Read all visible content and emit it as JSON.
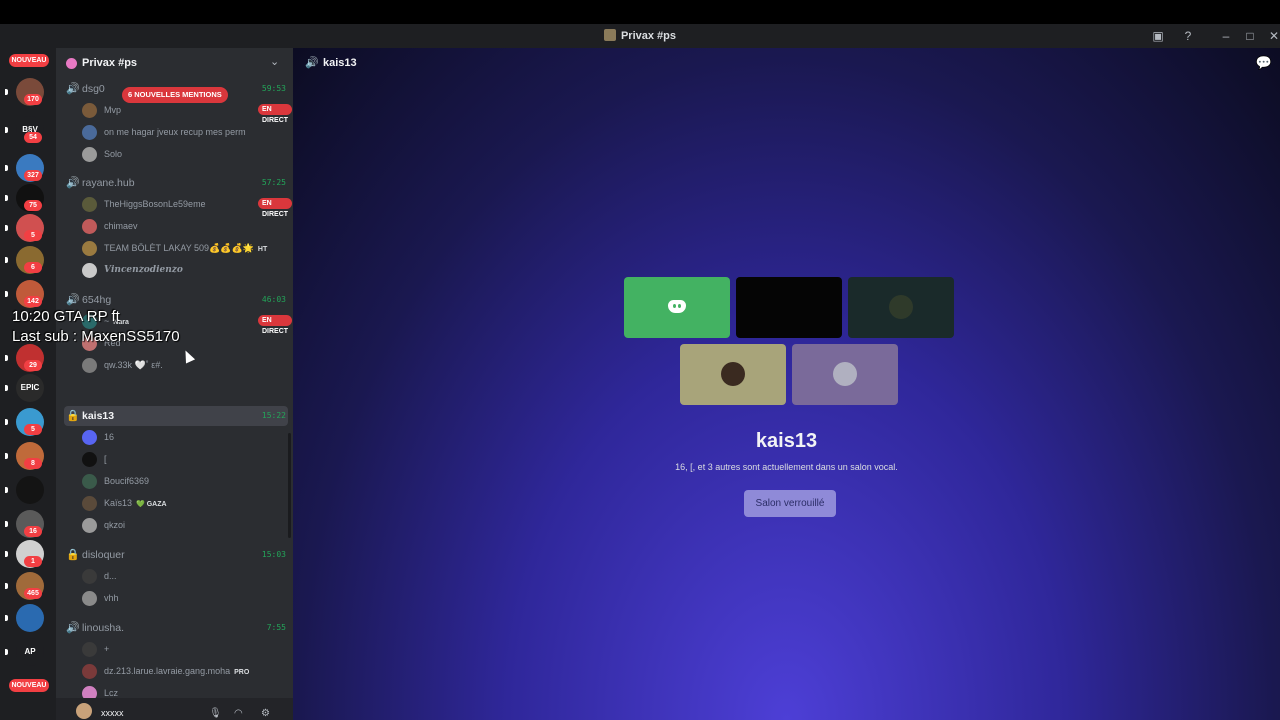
{
  "window": {
    "title": "Privax #ps"
  },
  "guilds": {
    "nouveau_top": "NOUVEAU",
    "nouveau_bottom": "NOUVEAU",
    "items": [
      {
        "badge": "170",
        "color": "#7a4a3a"
      },
      {
        "label": "B§V",
        "badge": "54",
        "color": "#1e1f22"
      },
      {
        "badge": "327",
        "color": "#3a7ac0"
      },
      {
        "badge": "75",
        "color": "#111111"
      },
      {
        "badge": "5",
        "color": "#d05050"
      },
      {
        "badge": "6",
        "color": "#8a6a30"
      },
      {
        "badge": "142",
        "color": "#c05a3a"
      },
      {
        "badge": "29",
        "color": "#c03030"
      },
      {
        "label": "EPIC",
        "badge": "",
        "color": "#2a2a2a"
      },
      {
        "badge": "5",
        "color": "#3a9ad0"
      },
      {
        "badge": "8",
        "color": "#c06a3a"
      },
      {
        "badge": "",
        "color": "#141414"
      },
      {
        "badge": "16",
        "color": "#5a5a5a"
      },
      {
        "badge": "1",
        "color": "#d0d0d0"
      },
      {
        "badge": "465",
        "color": "#a06a3a"
      },
      {
        "badge": "",
        "color": "#2a6ab0"
      },
      {
        "label": "AP",
        "badge": "",
        "color": "#1e1f22"
      }
    ]
  },
  "server": {
    "name": "Privax #ps"
  },
  "mentions_pill": "6 NOUVELLES MENTIONS",
  "live_label": "EN DIRECT",
  "voice_channels": [
    {
      "name": "dsg0",
      "time": "59:53",
      "locked": false,
      "users": [
        {
          "name": "Mvp",
          "live": true
        },
        {
          "name": "on me hagar jveux recup mes perm"
        },
        {
          "name": "Solo"
        }
      ]
    },
    {
      "name": "rayane.hub",
      "time": "57:25",
      "locked": false,
      "users": [
        {
          "name": "TheHiggsBosonLe59eme",
          "live": true
        },
        {
          "name": "chimaev"
        },
        {
          "name": "TEAM BÖLÈT LAKAY 509💰💰💰🌟",
          "tag": "HT"
        },
        {
          "name": "𝑽𝒊𝒏𝒄𝒆𝒏𝒛𝒐𝒅𝒊𝒆𝒏𝒛𝒐",
          "italic": true
        }
      ]
    },
    {
      "name": "654hg",
      "time": "46:03",
      "locked": false,
      "users": [
        {
          "name": "~",
          "tag": "Nara",
          "live": true
        },
        {
          "name": "Red"
        },
        {
          "name": "qw.33k 🤍˚ ε#."
        }
      ]
    },
    {
      "name": "kais13",
      "time": "15:22",
      "locked": true,
      "active": true,
      "users": [
        {
          "name": "16"
        },
        {
          "name": "["
        },
        {
          "name": "Boucif6369"
        },
        {
          "name": "Kaïs13",
          "tag": "💚 GAZA"
        },
        {
          "name": "qkzoi"
        }
      ]
    },
    {
      "name": "disloquer",
      "time": "15:03",
      "locked": true,
      "users": [
        {
          "name": "d..."
        },
        {
          "name": "vhh"
        }
      ]
    },
    {
      "name": "linousha.",
      "time": "7:55",
      "locked": false,
      "users": [
        {
          "name": "+"
        },
        {
          "name": "dz.213.larue.lavraie.gang.moha",
          "tag": "PRO"
        },
        {
          "name": "Lcz"
        }
      ]
    }
  ],
  "overlay": {
    "line1": "10:20 GTA RP ft",
    "line2": "Last sub : MaxenSS5170"
  },
  "user_panel": {
    "name": "xxxxx"
  },
  "main": {
    "channel_name": "kais13",
    "title": "kais13",
    "subtitle": "16, [, et 3 autres sont actuellement dans un salon vocal.",
    "button": "Salon verrouillé",
    "tiles": [
      {
        "bg": "#43b262",
        "kind": "discord"
      },
      {
        "bg": "#050505",
        "kind": "blank"
      },
      {
        "bg": "#1a2a2a",
        "kind": "avatar",
        "av": "#2f3a2a"
      },
      {
        "bg": "#a8a47a",
        "kind": "avatar",
        "av": "#3a2a20"
      },
      {
        "bg": "#7a6a9a",
        "kind": "avatar",
        "av": "#b0b0c0"
      }
    ]
  },
  "colors": {
    "accent_green": "#23a559",
    "live_red": "#da373c",
    "button": "#8f8ad8"
  }
}
